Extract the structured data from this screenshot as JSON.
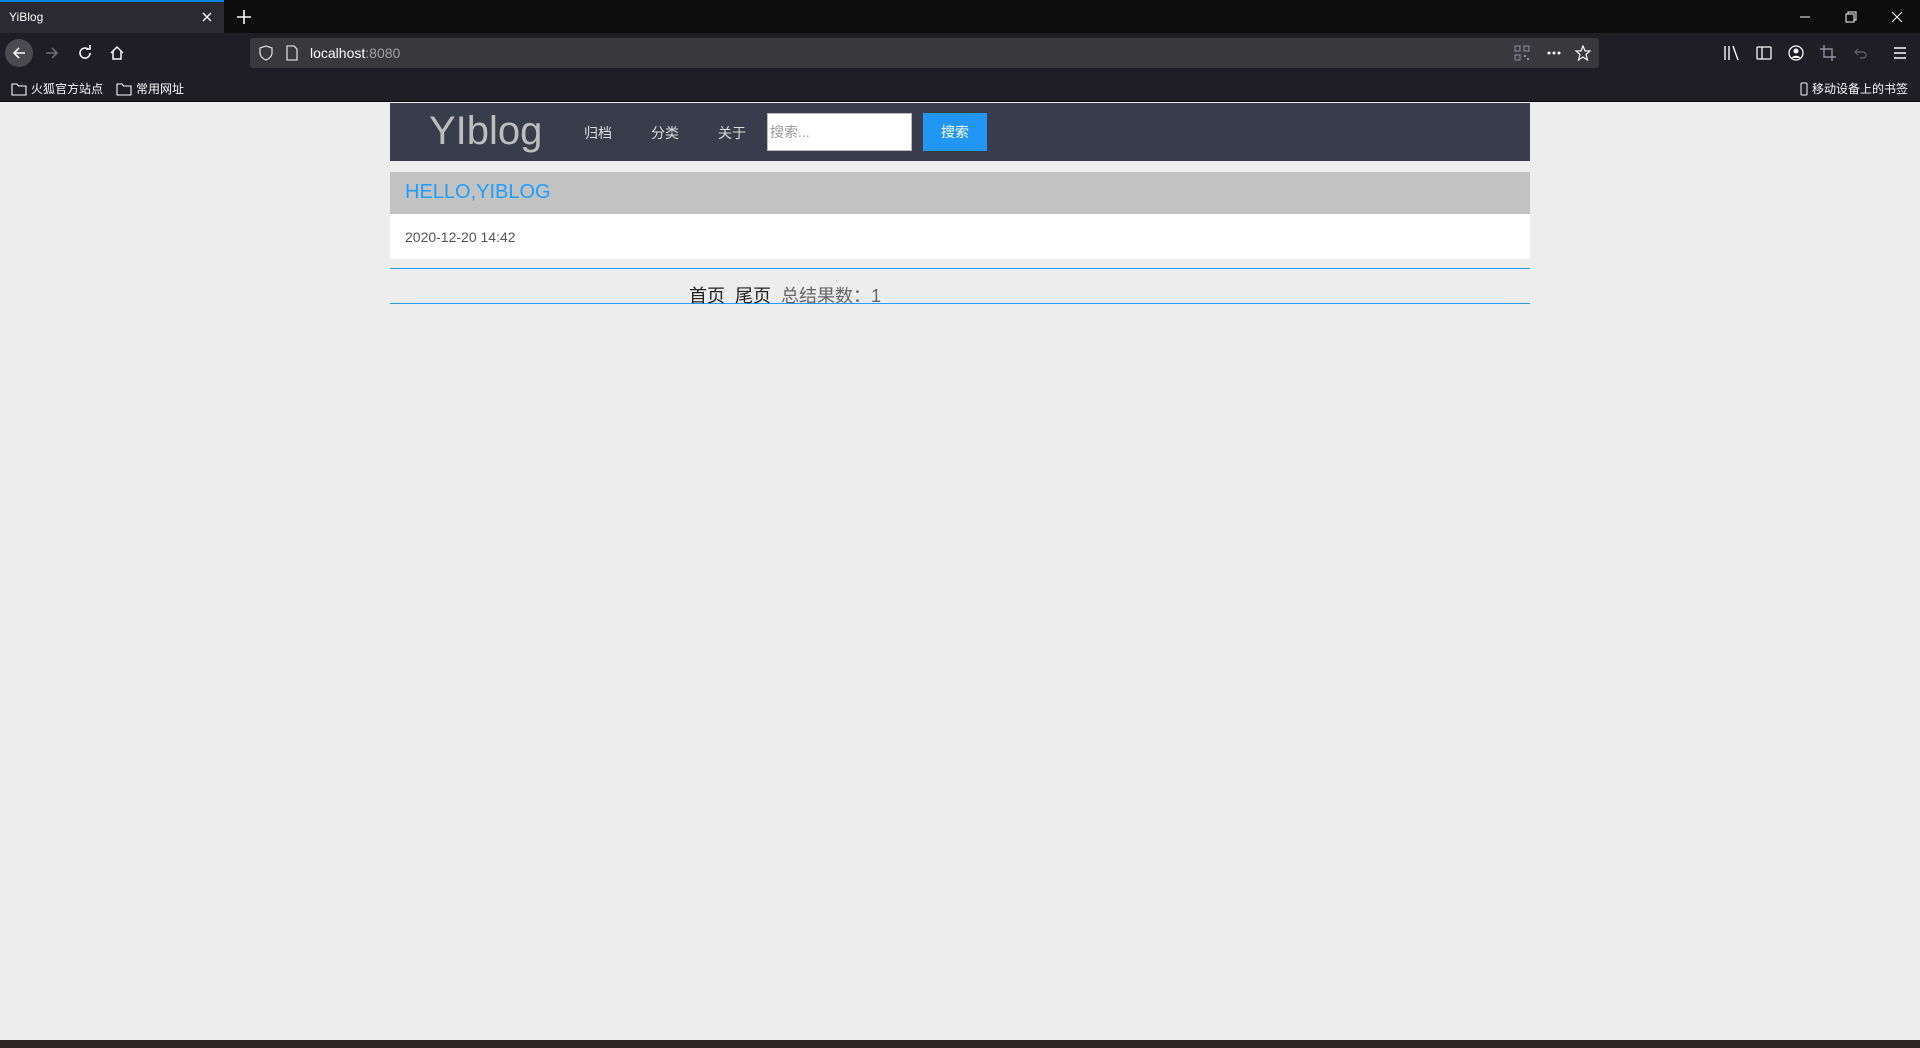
{
  "browser": {
    "tab_title": "YiBlog",
    "url_host": "localhost",
    "url_port": ":8080",
    "bookmarks": [
      "火狐官方站点",
      "常用网址"
    ],
    "mobile_bookmarks": "移动设备上的书签"
  },
  "site": {
    "logo": "YIblog",
    "nav": [
      "归档",
      "分类",
      "关于"
    ],
    "search": {
      "placeholder": "搜索...",
      "button": "搜索"
    }
  },
  "posts": [
    {
      "title": "HELLO,YIBLOG",
      "date": "2020-12-20 14:42"
    }
  ],
  "pager": {
    "first": "首页",
    "last": "尾页",
    "total_label": "总结果数：",
    "total": "1"
  },
  "colors": {
    "accent": "#1e9fff",
    "button": "#2196f3",
    "header_bg": "#393d4b"
  }
}
